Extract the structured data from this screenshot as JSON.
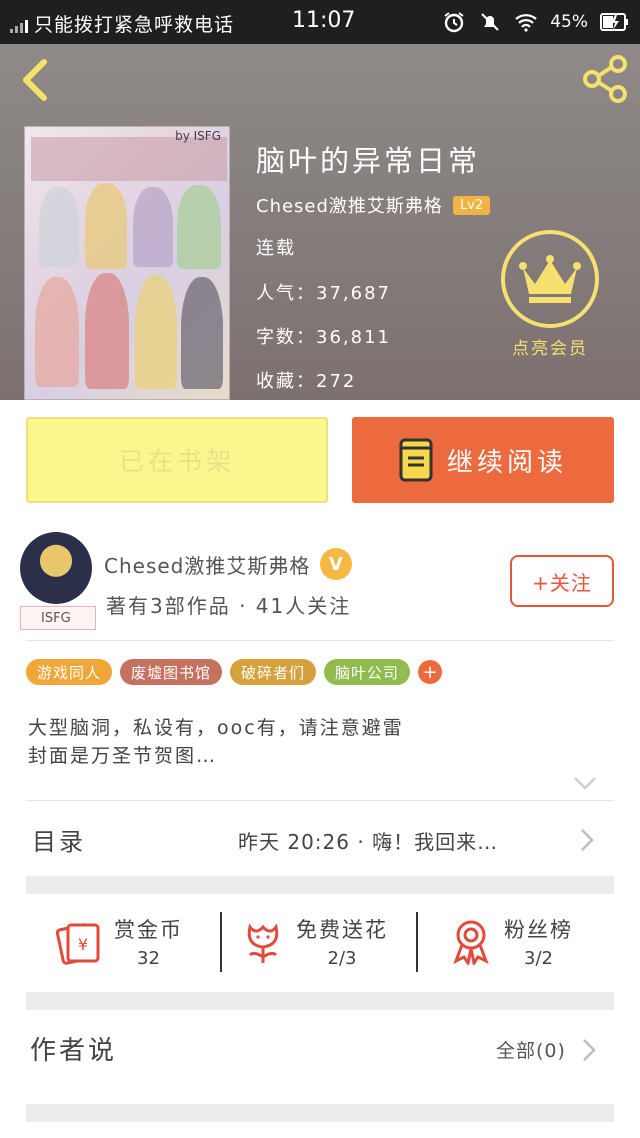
{
  "status_bar": {
    "carrier_text": "只能拨打紧急呼救电话",
    "time": "11:07",
    "battery": "45%",
    "icons": [
      "signal-icon",
      "alarm-icon",
      "mute-icon",
      "wifi-icon",
      "battery-charging-icon"
    ]
  },
  "header": {
    "book_title": "脑叶的异常日常",
    "author": "Chesed激推艾斯弗格",
    "level": "Lv2",
    "status": "连载",
    "popularity": "人气：37,687",
    "word_count": "字数：36,811",
    "favorites": "收藏：272",
    "vip_label": "点亮会员",
    "cover_text": "by ISFG",
    "icons": [
      "back-icon",
      "share-icon",
      "crown-icon"
    ]
  },
  "actions": {
    "shelf_label": "已在书架",
    "read_label": "继续阅读"
  },
  "author_card": {
    "name": "Chesed激推艾斯弗格",
    "verified": "V",
    "stats": "著有3部作品 · 41人关注",
    "follow_label": "+关注",
    "avatar_tag": "ISFG"
  },
  "tags": [
    {
      "label": "游戏同人",
      "color": "#f0a73a"
    },
    {
      "label": "废墟图书馆",
      "color": "#c4725f"
    },
    {
      "label": "破碎者们",
      "color": "#d6a03c"
    },
    {
      "label": "脑叶公司",
      "color": "#8fbb4f"
    }
  ],
  "description": {
    "line1": "大型脑洞，私设有，ooc有，请注意避雷",
    "line2": "封面是万圣节贺图…"
  },
  "toc": {
    "title": "目录",
    "latest": "昨天 20:26 · 嗨！我回来…"
  },
  "stats": [
    {
      "label": "赏金币",
      "value": "32",
      "icon": "red-envelope-icon"
    },
    {
      "label": "免费送花",
      "value": "2/3",
      "icon": "flower-icon"
    },
    {
      "label": "粉丝榜",
      "value": "3/2",
      "icon": "ribbon-icon"
    }
  ],
  "author_says": {
    "title": "作者说",
    "all_label": "全部(0)"
  },
  "colors": {
    "accent_orange": "#ec6a3e",
    "shelf_yellow": "#fbf78e",
    "vip_yellow": "#f5e070",
    "level_badge": "#f1b444"
  }
}
